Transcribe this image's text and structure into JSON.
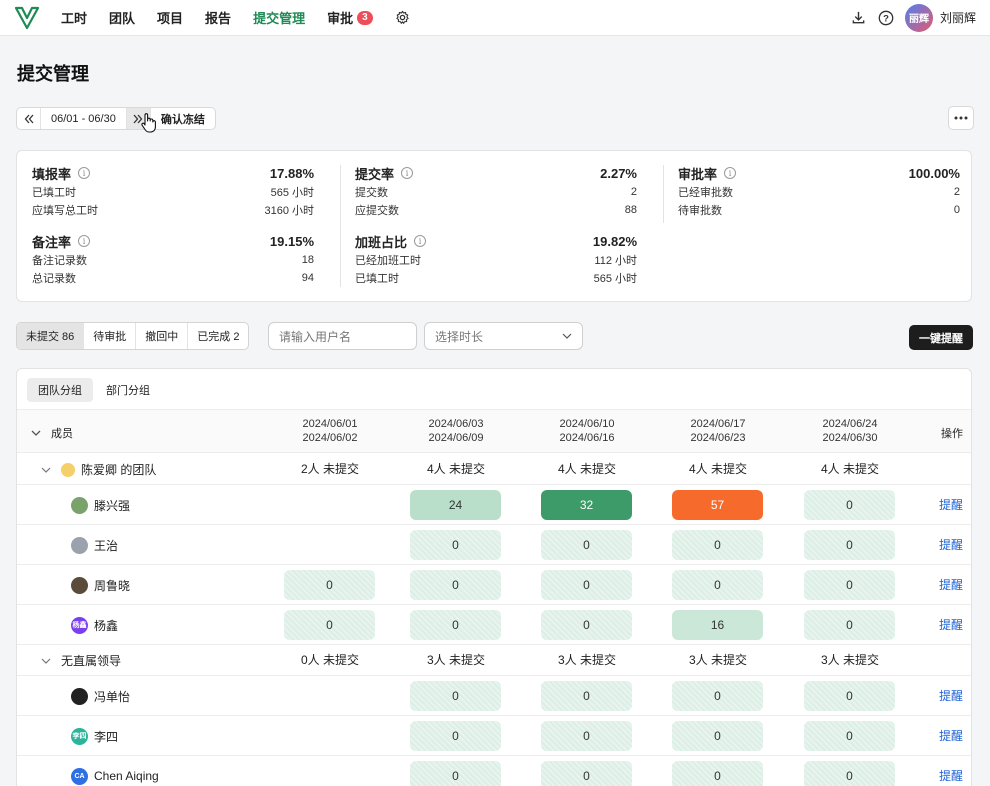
{
  "nav": {
    "items": [
      {
        "label": "工时",
        "active": false
      },
      {
        "label": "团队",
        "active": false
      },
      {
        "label": "项目",
        "active": false
      },
      {
        "label": "报告",
        "active": false
      },
      {
        "label": "提交管理",
        "active": true
      },
      {
        "label": "审批",
        "active": false,
        "badge": "3"
      }
    ],
    "user_name": "刘丽辉",
    "avatar_text": "丽辉",
    "accent_color": "#1f8a55"
  },
  "page": {
    "title": "提交管理"
  },
  "range": {
    "text": "06/01 - 06/30",
    "freeze_label": "确认冻结"
  },
  "stats": {
    "fill_rate": {
      "label": "填报率",
      "value": "17.88%",
      "rows": [
        {
          "k": "已填工时",
          "v": "565 小时"
        },
        {
          "k": "应填写总工时",
          "v": "3160 小时"
        }
      ]
    },
    "submit_rate": {
      "label": "提交率",
      "value": "2.27%",
      "rows": [
        {
          "k": "提交数",
          "v": "2"
        },
        {
          "k": "应提交数",
          "v": "88"
        }
      ]
    },
    "approve_rate": {
      "label": "审批率",
      "value": "100.00%",
      "rows": [
        {
          "k": "已经审批数",
          "v": "2"
        },
        {
          "k": "待审批数",
          "v": "0"
        }
      ]
    },
    "note_rate": {
      "label": "备注率",
      "value": "19.15%",
      "rows": [
        {
          "k": "备注记录数",
          "v": "18"
        },
        {
          "k": "总记录数",
          "v": "94"
        }
      ]
    },
    "overtime_rate": {
      "label": "加班占比",
      "value": "19.82%",
      "rows": [
        {
          "k": "已经加班工时",
          "v": "112 小时"
        },
        {
          "k": "已填工时",
          "v": "565 小时"
        }
      ]
    }
  },
  "filters": {
    "status_tabs": [
      {
        "label": "未提交 86",
        "active": true
      },
      {
        "label": "待审批",
        "active": false
      },
      {
        "label": "撤回中",
        "active": false
      },
      {
        "label": "已完成 2",
        "active": false
      }
    ],
    "user_placeholder": "请输入用户名",
    "duration_placeholder": "选择时长",
    "remind_all_label": "一键提醒"
  },
  "table": {
    "group_tabs": [
      {
        "label": "团队分组",
        "active": true
      },
      {
        "label": "部门分组",
        "active": false
      }
    ],
    "member_header": "成员",
    "op_header": "操作",
    "periods": [
      {
        "start": "2024/06/01",
        "end": "2024/06/02"
      },
      {
        "start": "2024/06/03",
        "end": "2024/06/09"
      },
      {
        "start": "2024/06/10",
        "end": "2024/06/16"
      },
      {
        "start": "2024/06/17",
        "end": "2024/06/23"
      },
      {
        "start": "2024/06/24",
        "end": "2024/06/30"
      }
    ],
    "remind_label": "提醒",
    "groups": [
      {
        "name": "陈爱卿 的团队",
        "summary": [
          "2人 未提交",
          "4人 未提交",
          "4人 未提交",
          "4人 未提交",
          "4人 未提交"
        ],
        "members": [
          {
            "name": "滕兴强",
            "avatar_color": "#7aa36b",
            "avatar_text": "",
            "values": [
              null,
              "24",
              "32",
              "57",
              "0"
            ],
            "levels": [
              null,
              "mid",
              "dark",
              "hot",
              "light"
            ]
          },
          {
            "name": "王治",
            "avatar_color": "#9aa3ad",
            "avatar_text": "",
            "values": [
              null,
              "0",
              "0",
              "0",
              "0"
            ],
            "levels": [
              null,
              "light",
              "light",
              "light",
              "light"
            ]
          },
          {
            "name": "周鲁晓",
            "avatar_color": "#5b4b3a",
            "avatar_text": "",
            "values": [
              "0",
              "0",
              "0",
              "0",
              "0"
            ],
            "levels": [
              "light",
              "light",
              "light",
              "light",
              "light"
            ]
          },
          {
            "name": "杨鑫",
            "avatar_color": "#7b3ff2",
            "avatar_text": "杨鑫",
            "values": [
              "0",
              "0",
              "0",
              "16",
              "0"
            ],
            "levels": [
              "light",
              "light",
              "light",
              "lightmid",
              "light"
            ]
          }
        ]
      },
      {
        "name": "无直属领导",
        "summary": [
          "0人 未提交",
          "3人 未提交",
          "3人 未提交",
          "3人 未提交",
          "3人 未提交"
        ],
        "members": [
          {
            "name": "冯单怡",
            "avatar_color": "#222222",
            "avatar_text": "",
            "values": [
              null,
              "0",
              "0",
              "0",
              "0"
            ],
            "levels": [
              null,
              "light",
              "light",
              "light",
              "light"
            ]
          },
          {
            "name": "李四",
            "avatar_color": "#2bb39b",
            "avatar_text": "李四",
            "values": [
              null,
              "0",
              "0",
              "0",
              "0"
            ],
            "levels": [
              null,
              "light",
              "light",
              "light",
              "light"
            ]
          },
          {
            "name": "Chen Aiqing",
            "avatar_color": "#2f6fe4",
            "avatar_text": "CA",
            "values": [
              null,
              "0",
              "0",
              "0",
              "0"
            ],
            "levels": [
              null,
              "light",
              "light",
              "light",
              "light"
            ]
          }
        ]
      }
    ]
  }
}
